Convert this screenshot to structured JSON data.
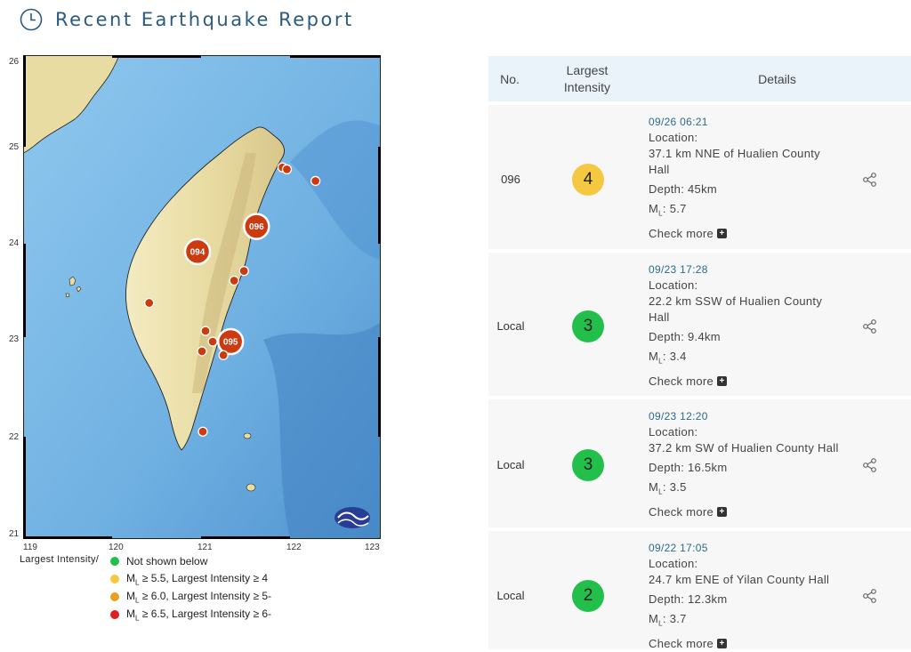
{
  "header": {
    "title": "Recent Earthquake Report"
  },
  "map": {
    "x_ticks": [
      "119",
      "120",
      "121",
      "122",
      "123"
    ],
    "y_ticks": [
      "26",
      "25",
      "24",
      "23",
      "22",
      "21"
    ],
    "markers": [
      {
        "label": "094",
        "lon": 120.95,
        "lat": 23.97,
        "size": "large"
      },
      {
        "label": "095",
        "lon": 121.32,
        "lat": 23.04,
        "size": "large"
      },
      {
        "label": "096",
        "lon": 121.61,
        "lat": 24.23,
        "size": "large"
      },
      {
        "label": "",
        "lon": 120.41,
        "lat": 23.44,
        "size": "small"
      },
      {
        "label": "",
        "lon": 121.04,
        "lat": 23.15,
        "size": "small"
      },
      {
        "label": "",
        "lon": 121.12,
        "lat": 23.04,
        "size": "small"
      },
      {
        "label": "",
        "lon": 121.0,
        "lat": 22.94,
        "size": "small"
      },
      {
        "label": "",
        "lon": 121.24,
        "lat": 22.9,
        "size": "small"
      },
      {
        "label": "",
        "lon": 121.36,
        "lat": 23.67,
        "size": "small"
      },
      {
        "label": "",
        "lon": 121.47,
        "lat": 23.77,
        "size": "small"
      },
      {
        "label": "",
        "lon": 121.9,
        "lat": 24.84,
        "size": "small"
      },
      {
        "label": "",
        "lon": 121.95,
        "lat": 24.82,
        "size": "small"
      },
      {
        "label": "",
        "lon": 122.27,
        "lat": 24.7,
        "size": "small"
      },
      {
        "label": "",
        "lon": 121.01,
        "lat": 22.11,
        "size": "small"
      }
    ]
  },
  "legend": {
    "title": "Largest Intensity/",
    "items": [
      {
        "color": "#22c04a",
        "text": "Not shown below"
      },
      {
        "color": "#f5c842",
        "ml": "M",
        "sub": "L",
        "text": " ≥ 5.5, Largest Intensity ≥ 4"
      },
      {
        "color": "#e8a020",
        "ml": "M",
        "sub": "L",
        "text": " ≥ 6.0, Largest Intensity ≥ 5-"
      },
      {
        "color": "#e02020",
        "ml": "M",
        "sub": "L",
        "text": " ≥ 6.5, Largest Intensity ≥ 6-"
      }
    ]
  },
  "table": {
    "col_no": "No.",
    "col_intensity_1": "Largest",
    "col_intensity_2": "Intensity",
    "col_details": "Details",
    "depth_label": "Depth: ",
    "ml_label": "M",
    "ml_sub": "L",
    "location_label": "Location:",
    "check_more": "Check more",
    "rows": [
      {
        "no": "096",
        "intensity": "4",
        "color": "#f5c842",
        "time": "09/26 06:21",
        "loc1": "37.1 km NNE of Hualien County",
        "loc2": "Hall",
        "depth": "45km",
        "mag": "5.7"
      },
      {
        "no": "Local",
        "intensity": "3",
        "color": "#22c04a",
        "time": "09/23 17:28",
        "loc1": "22.2 km SSW of Hualien County",
        "loc2": "Hall",
        "depth": "9.4km",
        "mag": "3.4"
      },
      {
        "no": "Local",
        "intensity": "3",
        "color": "#22c04a",
        "time": "09/23 12:20",
        "loc1": "37.2 km SW of Hualien County Hall",
        "loc2": "",
        "depth": "16.5km",
        "mag": "3.5"
      },
      {
        "no": "Local",
        "intensity": "2",
        "color": "#22c04a",
        "time": "09/22 17:05",
        "loc1": "24.7 km ENE of Yilan County Hall",
        "loc2": "",
        "depth": "12.3km",
        "mag": "3.7"
      }
    ]
  }
}
